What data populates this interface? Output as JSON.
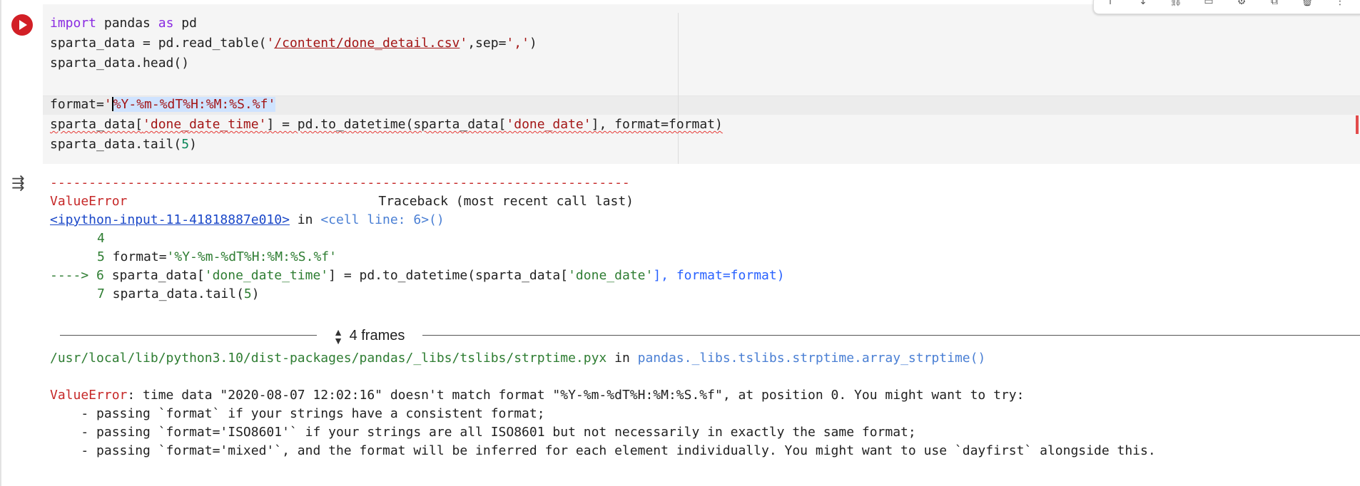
{
  "code": {
    "line1_kw1": "import",
    "line1_mid": " pandas ",
    "line1_kw2": "as",
    "line1_end": " pd",
    "line2_a": "sparta_data = pd.read_table(",
    "line2_q1": "'",
    "line2_path": "/content/done_detail.csv",
    "line2_q2": "'",
    "line2_b": ",sep=",
    "line2_sep": "','",
    "line2_c": ")",
    "line3": "sparta_data.head()",
    "line5_a": "format=",
    "line5_q": "'",
    "line5_fmt": "%Y-%m-%dT%H:%M:%S.%f'",
    "line6_a": "sparta_data[",
    "line6_key": "'done_date_time'",
    "line6_b": "] = pd.to_datetime(sparta_data[",
    "line6_key2": "'done_date'",
    "line6_c": "], format=format)",
    "line7_a": "sparta_data.tail(",
    "line7_num": "5",
    "line7_b": ")"
  },
  "output": {
    "dashes": "---------------------------------------------------------------------------",
    "error_type": "ValueError",
    "traceback_header": "Traceback (most recent call last)",
    "ipython_link": "<ipython-input-11-41818887e010>",
    "in_word": " in ",
    "cell_ref": "<cell line: 6>",
    "cell_paren": "()",
    "tb4_num": "4",
    "tb5_num": "5",
    "tb5_a": " format=",
    "tb5_str": "'%Y-%m-%dT%H:%M:%S.%f'",
    "tb6_arrow": "----> 6",
    "tb6_a": " sparta_data[",
    "tb6_key": "'done_date_time'",
    "tb6_b": "] = pd.to_datetime(sparta_data[",
    "tb6_key2": "'done_date'",
    "tb6_c": "], format=format)",
    "tb7_num": "7",
    "tb7_a": " sparta_data.tail(",
    "tb7_num2": "5",
    "tb7_b": ")",
    "frames_label": "4 frames",
    "lib_path": "/usr/local/lib/python3.10/dist-packages/pandas/_libs/tslibs/strptime.pyx",
    "lib_in": " in ",
    "lib_func": "pandas._libs.tslibs.strptime.array_strptime()",
    "err_label": "ValueError",
    "err_msg": ": time data \"2020-08-07 12:02:16\" doesn't match format \"%Y-%m-%dT%H:%M:%S.%f\", at position 0. You might want to try:",
    "hint1": "    - passing `format` if your strings have a consistent format;",
    "hint2": "    - passing `format='ISO8601'` if your strings are all ISO8601 but not necessarily in exactly the same format;",
    "hint3": "    - passing `format='mixed'`, and the format will be inferred for each element individually. You might want to use `dayfirst` alongside this."
  },
  "toolbar": {
    "icons": [
      "arrow-up-icon",
      "arrow-down-icon",
      "link-icon",
      "comment-icon",
      "gear-icon",
      "mirror-cell-icon",
      "delete-icon",
      "more-icon"
    ]
  },
  "colors": {
    "run_button": "#d21f26",
    "error_red": "#c62828",
    "keyword": "#8a2be2"
  }
}
